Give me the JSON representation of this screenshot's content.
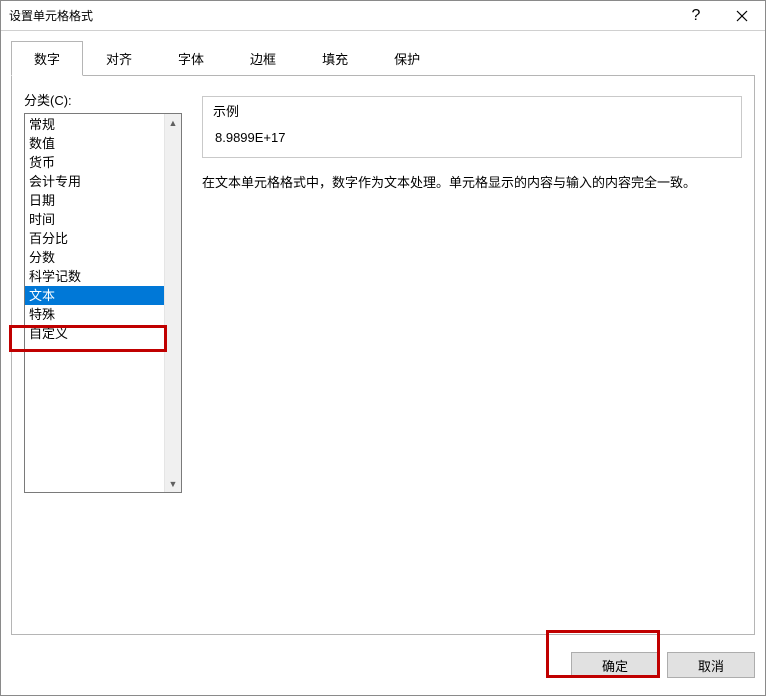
{
  "titlebar": {
    "title": "设置单元格格式",
    "help_char": "?",
    "close_label": "close-icon"
  },
  "tabs": [
    {
      "label": "数字",
      "active": true
    },
    {
      "label": "对齐",
      "active": false
    },
    {
      "label": "字体",
      "active": false
    },
    {
      "label": "边框",
      "active": false
    },
    {
      "label": "填充",
      "active": false
    },
    {
      "label": "保护",
      "active": false
    }
  ],
  "left": {
    "label": "分类(C):",
    "items": [
      "常规",
      "数值",
      "货币",
      "会计专用",
      "日期",
      "时间",
      "百分比",
      "分数",
      "科学记数",
      "文本",
      "特殊",
      "自定义"
    ],
    "selected_index": 9
  },
  "right": {
    "example_label": "示例",
    "example_value": "8.9899E+17",
    "description": "在文本单元格格式中，数字作为文本处理。单元格显示的内容与输入的内容完全一致。"
  },
  "footer": {
    "ok_label": "确定",
    "cancel_label": "取消"
  }
}
